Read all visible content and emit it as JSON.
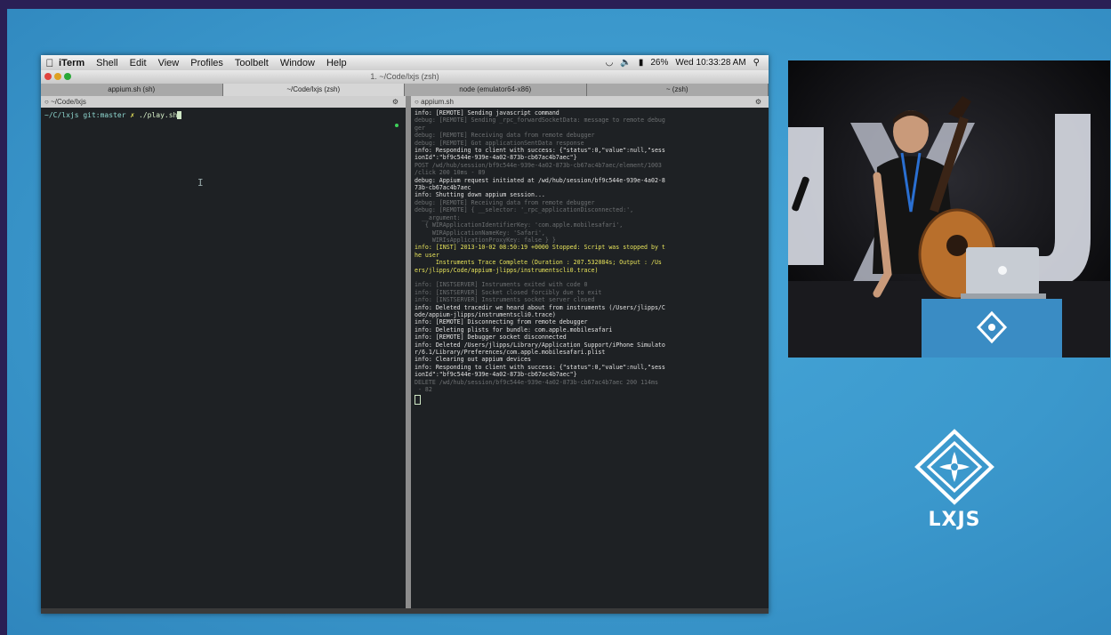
{
  "menubar": {
    "items": [
      "iTerm",
      "Shell",
      "Edit",
      "View",
      "Profiles",
      "Toolbelt",
      "Window",
      "Help"
    ],
    "battery": "26%",
    "clock": "Wed 10:33:28 AM"
  },
  "window": {
    "title": "1. ~/Code/lxjs (zsh)"
  },
  "tabs": [
    "appium.sh (sh)",
    "~/Code/lxjs (zsh)",
    "node (emulator64-x86)",
    "~ (zsh)"
  ],
  "panes": {
    "left_title": "~/Code/lxjs",
    "right_title": "appium.sh",
    "prompt_path": "~/C/lxjs git:master",
    "prompt_mark": "✗",
    "prompt_command": "./play.sh"
  },
  "log_lines": [
    {
      "text": "info: [REMOTE] Sending javascript command",
      "style": "n"
    },
    {
      "text": "debug: [REMOTE] Sending _rpc_forwardSocketData: message to remote debug",
      "style": "dim"
    },
    {
      "text": "ger",
      "style": "dim"
    },
    {
      "text": "debug: [REMOTE] Receiving data from remote debugger",
      "style": "dim"
    },
    {
      "text": "debug: [REMOTE] Got applicationSentData response",
      "style": "dim"
    },
    {
      "text": "info: Responding to client with success: {\"status\":0,\"value\":null,\"sess",
      "style": "n"
    },
    {
      "text": "ionId\":\"bf9c544e-939e-4a02-873b-cb67ac4b7aec\"}",
      "style": "n"
    },
    {
      "text": "POST /wd/hub/session/bf9c544e-939e-4a02-873b-cb67ac4b7aec/element/1003",
      "style": "dim"
    },
    {
      "text": "/click 200 10ms - 89",
      "style": "dim"
    },
    {
      "text": "debug: Appium request initiated at /wd/hub/session/bf9c544e-939e-4a02-8",
      "style": "n"
    },
    {
      "text": "73b-cb67ac4b7aec",
      "style": "n"
    },
    {
      "text": "info: Shutting down appium session...",
      "style": "n"
    },
    {
      "text": "debug: [REMOTE] Receiving data from remote debugger",
      "style": "dim"
    },
    {
      "text": "debug: [REMOTE] { __selector: '_rpc_applicationDisconnected:',",
      "style": "dim"
    },
    {
      "text": "  __argument:",
      "style": "dim"
    },
    {
      "text": "   { WIRApplicationIdentifierKey: 'com.apple.mobilesafari',",
      "style": "dim"
    },
    {
      "text": "     WIRApplicationNameKey: 'Safari',",
      "style": "dim"
    },
    {
      "text": "     WIRIsApplicationProxyKey: false } }",
      "style": "dim"
    },
    {
      "text": "info: [INST] 2013-10-02 08:50:19 +0000 Stopped: Script was stopped by t",
      "style": "y"
    },
    {
      "text": "he user",
      "style": "y"
    },
    {
      "text": "      Instruments Trace Complete (Duration : 207.532084s; Output : /Us",
      "style": "y"
    },
    {
      "text": "ers/jlipps/Code/appium-jlipps/instrumentscli0.trace)",
      "style": "y"
    },
    {
      "text": "",
      "style": "blank"
    },
    {
      "text": "info: [INSTSERVER] Instruments exited with code 0",
      "style": "dim"
    },
    {
      "text": "info: [INSTSERVER] Socket closed forcibly due to exit",
      "style": "dim"
    },
    {
      "text": "info: [INSTSERVER] Instruments socket server closed",
      "style": "dim"
    },
    {
      "text": "info: Deleted tracedir we heard about from instruments (/Users/jlipps/C",
      "style": "n"
    },
    {
      "text": "ode/appium-jlipps/instrumentscli0.trace)",
      "style": "n"
    },
    {
      "text": "info: [REMOTE] Disconnecting from remote debugger",
      "style": "n"
    },
    {
      "text": "info: Deleting plists for bundle: com.apple.mobilesafari",
      "style": "n"
    },
    {
      "text": "info: [REMOTE] Debugger socket disconnected",
      "style": "n"
    },
    {
      "text": "info: Deleted /Users/jlipps/Library/Application Support/iPhone Simulato",
      "style": "n"
    },
    {
      "text": "r/6.1/Library/Preferences/com.apple.mobilesafari.plist",
      "style": "n"
    },
    {
      "text": "info: Clearing out appium devices",
      "style": "n"
    },
    {
      "text": "info: Responding to client with success: {\"status\":0,\"value\":null,\"sess",
      "style": "n"
    },
    {
      "text": "ionId\":\"bf9c544e-939e-4a02-873b-cb67ac4b7aec\"}",
      "style": "n"
    },
    {
      "text": "DELETE /wd/hub/session/bf9c544e-939e-4a02-873b-cb67ac4b7aec 200 114ms",
      "style": "dim"
    },
    {
      "text": " - 82",
      "style": "dim"
    }
  ],
  "brand": {
    "label": "LXJS"
  },
  "colors": {
    "stage": "#3b98cc",
    "terminal_bg": "#1e2124",
    "log_highlight": "#e7e35a",
    "prompt": "#8fd7d0"
  }
}
